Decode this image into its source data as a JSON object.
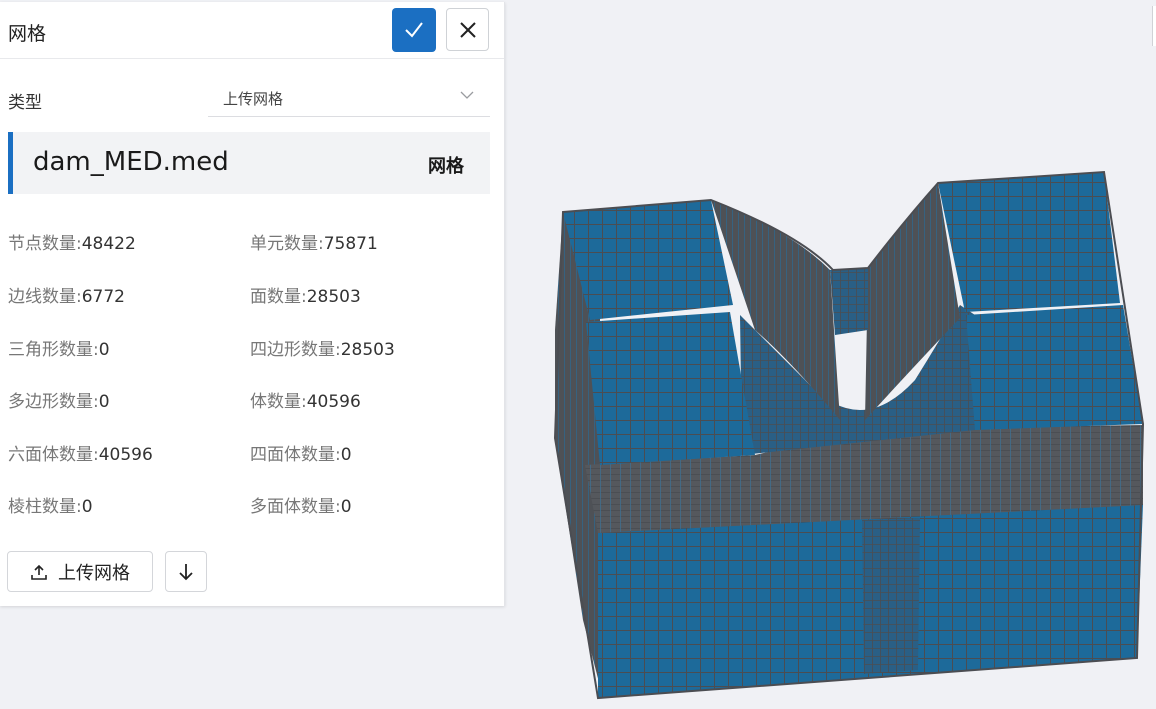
{
  "panel": {
    "title": "网格",
    "confirm_icon": "check-icon",
    "close_icon": "close-icon"
  },
  "type_field": {
    "label": "类型",
    "value": "上传网格"
  },
  "file": {
    "name": "dam_MED.med",
    "type": "网格"
  },
  "stats": [
    {
      "label": "节点数量:",
      "value": "48422"
    },
    {
      "label": "单元数量:",
      "value": "75871"
    },
    {
      "label": "边线数量:",
      "value": "6772"
    },
    {
      "label": "面数量:",
      "value": "28503"
    },
    {
      "label": "三角形数量:",
      "value": "0"
    },
    {
      "label": "四边形数量:",
      "value": "28503"
    },
    {
      "label": "多边形数量:",
      "value": "0"
    },
    {
      "label": "体数量:",
      "value": "40596"
    },
    {
      "label": "六面体数量:",
      "value": "40596"
    },
    {
      "label": "四面体数量:",
      "value": "0"
    },
    {
      "label": "棱柱数量:",
      "value": "0"
    },
    {
      "label": "多面体数量:",
      "value": "0"
    }
  ],
  "actions": {
    "upload_label": "上传网格",
    "upload_icon": "upload-icon",
    "download_icon": "download-icon"
  },
  "colors": {
    "accent": "#1b6fc2",
    "mesh_fill": "#1d6a9a",
    "mesh_line": "#4b4d52"
  }
}
